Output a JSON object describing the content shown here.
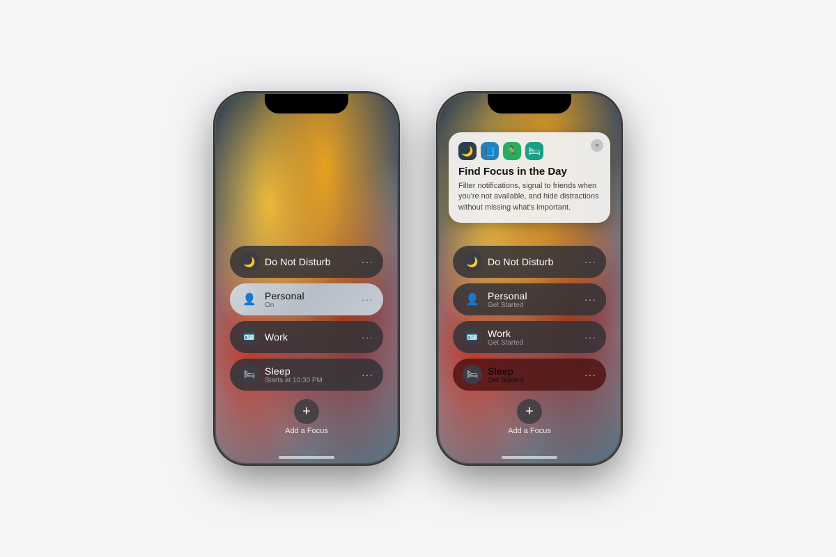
{
  "page": {
    "background": "#f5f5f7"
  },
  "phone1": {
    "items": [
      {
        "id": "dnd",
        "icon": "🌙",
        "title": "Do Not Disturb",
        "subtitle": "",
        "type": "dark"
      },
      {
        "id": "personal",
        "icon": "👤",
        "title": "Personal",
        "subtitle": "On",
        "type": "personal-active"
      },
      {
        "id": "work",
        "icon": "🪪",
        "title": "Work",
        "subtitle": "",
        "type": "dark"
      },
      {
        "id": "sleep",
        "icon": "🛏",
        "title": "Sleep",
        "subtitle": "Starts at 10:30 PM",
        "type": "dark"
      }
    ],
    "add_label": "Add a Focus"
  },
  "phone2": {
    "popup": {
      "title": "Find Focus in the Day",
      "description": "Filter notifications, signal to friends when you're not available, and hide distractions without missing what's important.",
      "icons": [
        "🌙",
        "📘",
        "🏃",
        "🛏"
      ],
      "close": "×"
    },
    "items": [
      {
        "id": "dnd",
        "icon": "🌙",
        "title": "Do Not Disturb",
        "subtitle": "",
        "type": "dark"
      },
      {
        "id": "personal",
        "icon": "👤",
        "title": "Personal",
        "subtitle": "Get Started",
        "type": "dark"
      },
      {
        "id": "work",
        "icon": "🪪",
        "title": "Work",
        "subtitle": "Get Started",
        "type": "dark"
      },
      {
        "id": "sleep",
        "icon": "🛏",
        "title": "Sleep",
        "subtitle": "Get Started",
        "type": "sleep-red"
      }
    ],
    "add_label": "Add a Focus"
  }
}
